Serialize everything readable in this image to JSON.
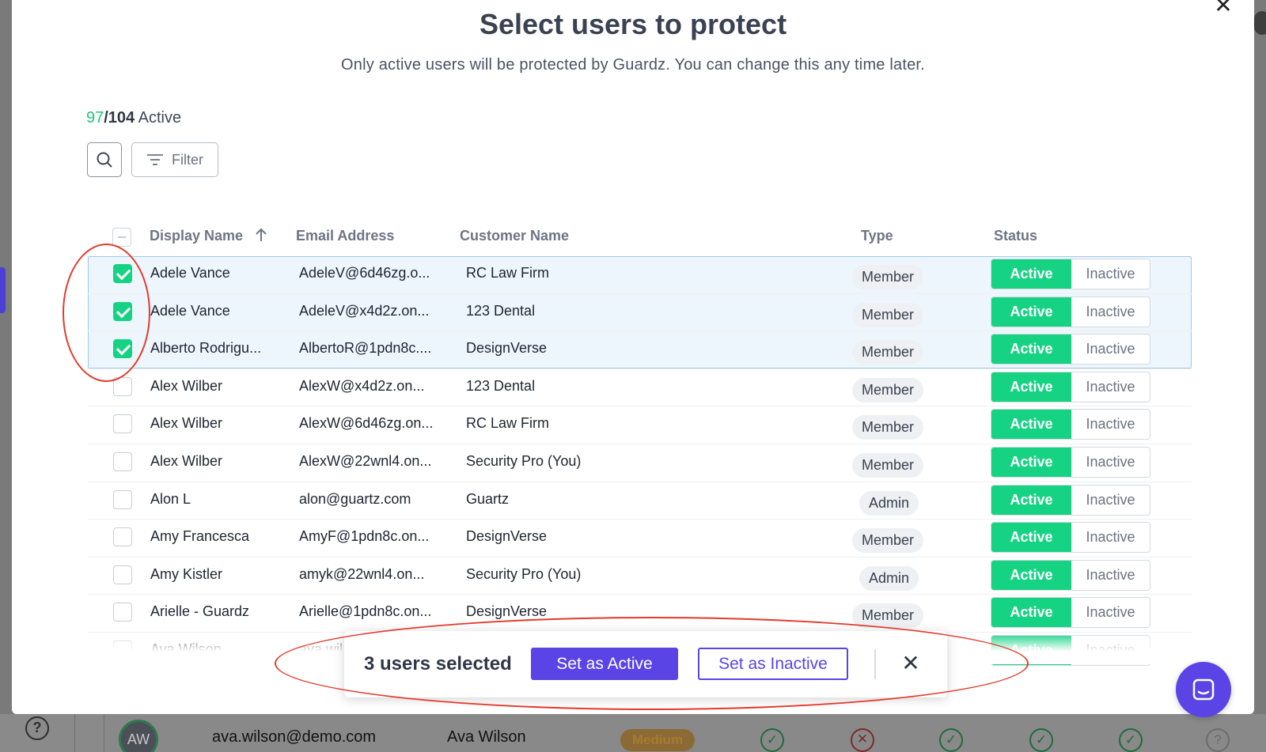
{
  "modal": {
    "title": "Select users to protect",
    "subtitle": "Only active users will be protected by Guardz. You can change this any time later.",
    "active_count": "97",
    "total_count": "/104",
    "active_word": " Active",
    "filter_label": "Filter"
  },
  "table": {
    "headers": {
      "display_name": "Display Name",
      "email": "Email Address",
      "customer": "Customer Name",
      "type": "Type",
      "status": "Status"
    },
    "rows": [
      {
        "name": "Adele Vance",
        "email": "AdeleV@6d46zg.o...",
        "customer": "RC Law Firm",
        "type": "Member",
        "active": "Active",
        "inactive": "Inactive",
        "checked": true
      },
      {
        "name": "Adele Vance",
        "email": "AdeleV@x4d2z.on...",
        "customer": "123 Dental",
        "type": "Member",
        "active": "Active",
        "inactive": "Inactive",
        "checked": true
      },
      {
        "name": "Alberto Rodrigu...",
        "email": "AlbertoR@1pdn8c....",
        "customer": "DesignVerse",
        "type": "Member",
        "active": "Active",
        "inactive": "Inactive",
        "checked": true
      },
      {
        "name": "Alex Wilber",
        "email": "AlexW@x4d2z.on...",
        "customer": "123 Dental",
        "type": "Member",
        "active": "Active",
        "inactive": "Inactive",
        "checked": false
      },
      {
        "name": "Alex Wilber",
        "email": "AlexW@6d46zg.on...",
        "customer": "RC Law Firm",
        "type": "Member",
        "active": "Active",
        "inactive": "Inactive",
        "checked": false
      },
      {
        "name": "Alex Wilber",
        "email": "AlexW@22wnl4.on...",
        "customer": "Security Pro (You)",
        "type": "Member",
        "active": "Active",
        "inactive": "Inactive",
        "checked": false
      },
      {
        "name": "Alon L",
        "email": "alon@guartz.com",
        "customer": "Guartz",
        "type": "Admin",
        "active": "Active",
        "inactive": "Inactive",
        "checked": false
      },
      {
        "name": "Amy Francesca",
        "email": "AmyF@1pdn8c.on...",
        "customer": "DesignVerse",
        "type": "Member",
        "active": "Active",
        "inactive": "Inactive",
        "checked": false
      },
      {
        "name": "Amy Kistler",
        "email": "amyk@22wnl4.on...",
        "customer": "Security Pro (You)",
        "type": "Admin",
        "active": "Active",
        "inactive": "Inactive",
        "checked": false
      },
      {
        "name": "Arielle - Guardz",
        "email": "Arielle@1pdn8c.on...",
        "customer": "DesignVerse",
        "type": "Member",
        "active": "Active",
        "inactive": "Inactive",
        "checked": false
      },
      {
        "name": "Ava Wilson",
        "email": "ava.wil...",
        "customer": "",
        "type": "",
        "active": "Active",
        "inactive": "Inactive",
        "checked": false
      }
    ]
  },
  "action_bar": {
    "selected_text": "3 users selected",
    "set_active": "Set as Active",
    "set_inactive": "Set as Inactive"
  },
  "background": {
    "avatar_initials": "AW",
    "email": "ava.wilson@demo.com",
    "name": "Ava Wilson",
    "risk": "Medium"
  },
  "colors": {
    "accent": "#5a44e6",
    "active_green": "#16d384",
    "annotation_red": "#e23b2d"
  }
}
